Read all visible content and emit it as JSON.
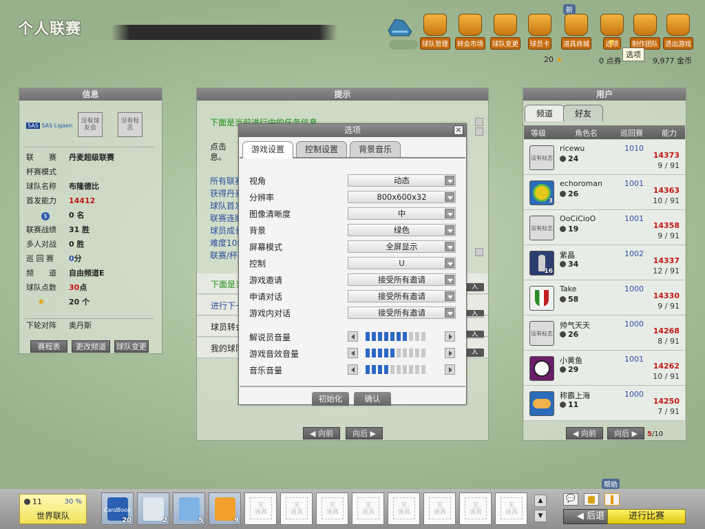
{
  "app_title": "个人联赛",
  "nav": {
    "items": [
      {
        "label": "球队管理",
        "icon": "whistle-icon"
      },
      {
        "label": "转会市场",
        "icon": "players-icon"
      },
      {
        "label": "球队变更",
        "icon": "ball-icon"
      },
      {
        "label": "球员卡",
        "icon": "card-icon"
      },
      {
        "label": "道具商城",
        "icon": "box-icon"
      },
      {
        "label": "选项",
        "icon": "dice-icon"
      },
      {
        "label": "制作团队",
        "icon": "magnet-icon"
      },
      {
        "label": "退出游戏",
        "icon": "exit-flag-icon"
      }
    ],
    "new_badge": "新",
    "tooltip": "选项",
    "stars": "20",
    "points": "0 点券",
    "gold": "9,977 金币"
  },
  "info": {
    "title": "信息",
    "sponsor": "SAS Ligaen",
    "badge1": "没有球友会",
    "badge2": "没有标志",
    "rows": [
      {
        "k": "联　　赛",
        "v": "丹麦超级联赛"
      },
      {
        "k": "杯赛模式",
        "v": ""
      },
      {
        "k": "球队名称",
        "v": "布隆德比"
      },
      {
        "k": "首发能力",
        "v": "14412"
      },
      {
        "k": "",
        "v": "0 名"
      },
      {
        "k": "联赛战绩",
        "v": "31 胜"
      },
      {
        "k": "多人对战",
        "v": "0 胜"
      },
      {
        "k": "巡 回 赛",
        "v": "0",
        "v2": "分"
      },
      {
        "k": "频　　道",
        "v": "自由频道E"
      },
      {
        "k": "球队点数",
        "v": "30",
        "v2": "点"
      },
      {
        "k": "",
        "v": "20 个"
      }
    ],
    "opponent_label": "下轮对阵",
    "opponent": "奥丹斯",
    "buttons": [
      "赛程表",
      "更改频道",
      "球队变更"
    ]
  },
  "hints": {
    "title": "提示",
    "line1": "下面是当前进行中的任务信息",
    "line2a": "点击",
    "line2b": "息。",
    "links": [
      "所有联赛",
      "获得丹麦",
      "球队首发",
      "联赛连胜",
      "球员成长",
      "难度10级",
      "联赛/杯赛"
    ],
    "rows": [
      "下面是当",
      "进行下一",
      "球员转会",
      "我的球队"
    ],
    "mini_label": "入",
    "prev": "向前",
    "next": "向后"
  },
  "users": {
    "title": "用户",
    "tabs": [
      "频道",
      "好友"
    ],
    "cols": [
      "等级",
      "角色名",
      "巡回赛",
      "能力"
    ],
    "no_logo": "没有标志",
    "list": [
      {
        "name": "ricewu",
        "lv": "24",
        "rank": "1010",
        "power": "14373",
        "rec": "9 / 91",
        "avatar": "default"
      },
      {
        "name": "echoroman",
        "lv": "26",
        "rank": "1001",
        "power": "14363",
        "rec": "10 / 91",
        "avatar": "globe",
        "num": "3"
      },
      {
        "name": "OoCiCioO",
        "lv": "19",
        "rank": "1001",
        "power": "14358",
        "rec": "9 / 91",
        "avatar": "default"
      },
      {
        "name": "紫晶",
        "lv": "34",
        "rank": "1002",
        "power": "14337",
        "rec": "12 / 91",
        "avatar": "trophy",
        "num": "16"
      },
      {
        "name": "Take",
        "lv": "58",
        "rank": "1000",
        "power": "14330",
        "rec": "9 / 91",
        "avatar": "crest"
      },
      {
        "name": "帅气天天",
        "lv": "26",
        "rank": "1000",
        "power": "14268",
        "rec": "8 / 91",
        "avatar": "default"
      },
      {
        "name": "小黄鱼",
        "lv": "29",
        "rank": "1001",
        "power": "14262",
        "rec": "10 / 91",
        "avatar": "ball"
      },
      {
        "name": "称霸上海",
        "lv": "11",
        "rank": "1000",
        "power": "14250",
        "rec": "7 / 91",
        "avatar": "arm"
      }
    ],
    "prev": "向前",
    "next": "向后",
    "page": "5",
    "total": "/10"
  },
  "dialog": {
    "title": "选项",
    "close": "×",
    "tabs": [
      "游戏设置",
      "控制设置",
      "背景音乐"
    ],
    "options": [
      {
        "label": "视角",
        "value": "动态"
      },
      {
        "label": "分辨率",
        "value": "800x600x32"
      },
      {
        "label": "图像清晰度",
        "value": "中"
      },
      {
        "label": "背景",
        "value": "绿色"
      },
      {
        "label": "屏幕模式",
        "value": "全屏显示"
      },
      {
        "label": "控制",
        "value": "U"
      },
      {
        "label": "游戏邀请",
        "value": "接受所有邀请"
      },
      {
        "label": "申请对话",
        "value": "接受所有邀请"
      },
      {
        "label": "游戏内对话",
        "value": "接受所有邀请"
      }
    ],
    "volumes": [
      {
        "label": "解说员音量",
        "level": 7,
        "max": 10
      },
      {
        "label": "游戏音效音量",
        "level": 5,
        "max": 10
      },
      {
        "label": "音乐音量",
        "level": 4,
        "max": 10
      }
    ],
    "btn_reset": "初始化",
    "btn_ok": "确认"
  },
  "bottom": {
    "level": "11",
    "exp": "30 %",
    "team": "世界联队",
    "no_item": "无\n道具",
    "items": [
      {
        "cnt": "20",
        "label": "CardBook"
      },
      {
        "cnt": "2",
        "label": ""
      },
      {
        "cnt": "5",
        "label": ""
      },
      {
        "cnt": "9",
        "label": ""
      }
    ],
    "help": "帮助",
    "back": "后退",
    "start": "进行比赛"
  },
  "colors": {
    "accent_red": "#c01818",
    "link_blue": "#2d4e9c",
    "green_text": "#1c8c16",
    "start_btn": "#f5e02a"
  }
}
